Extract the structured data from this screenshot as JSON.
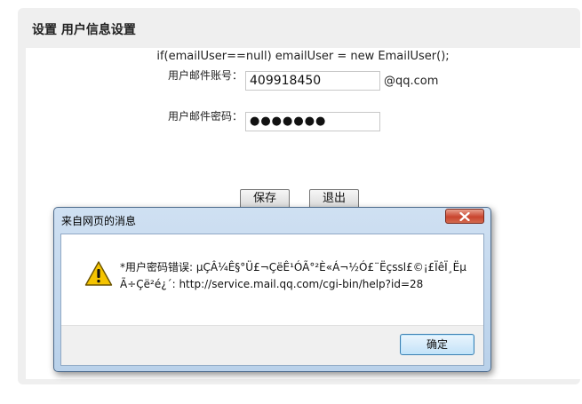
{
  "panel": {
    "title": "设置 用户信息设置"
  },
  "form": {
    "code_line": "if(emailUser==null) emailUser = new EmailUser();",
    "account_label": "用户邮件账号：",
    "account_value": "409918450",
    "account_suffix": "@qq.com",
    "password_label": "用户邮件密码：",
    "password_mask": "●●●●●●●",
    "save_label": "保存",
    "exit_label": "退出"
  },
  "dialog": {
    "title": "来自网页的消息",
    "message": "*用户密码错误: µÇÂ¼Ê§°Ü£¬ÇëÊ¹ÓÃ°²È«Á¬½Ó£¨Ëçssl£©¡£ÏêÏ¸Ëµ\nÃ÷Çë²é¿´: http://service.mail.qq.com/cgi-bin/help?id=28",
    "ok_label": "确定",
    "icon": "warning-icon",
    "close_icon": "close-icon"
  },
  "colors": {
    "dialog_frame": "#b9d1ea",
    "close_button": "#c9452f",
    "ok_button_border": "#3c7fb1",
    "warning_yellow": "#f5c400"
  }
}
